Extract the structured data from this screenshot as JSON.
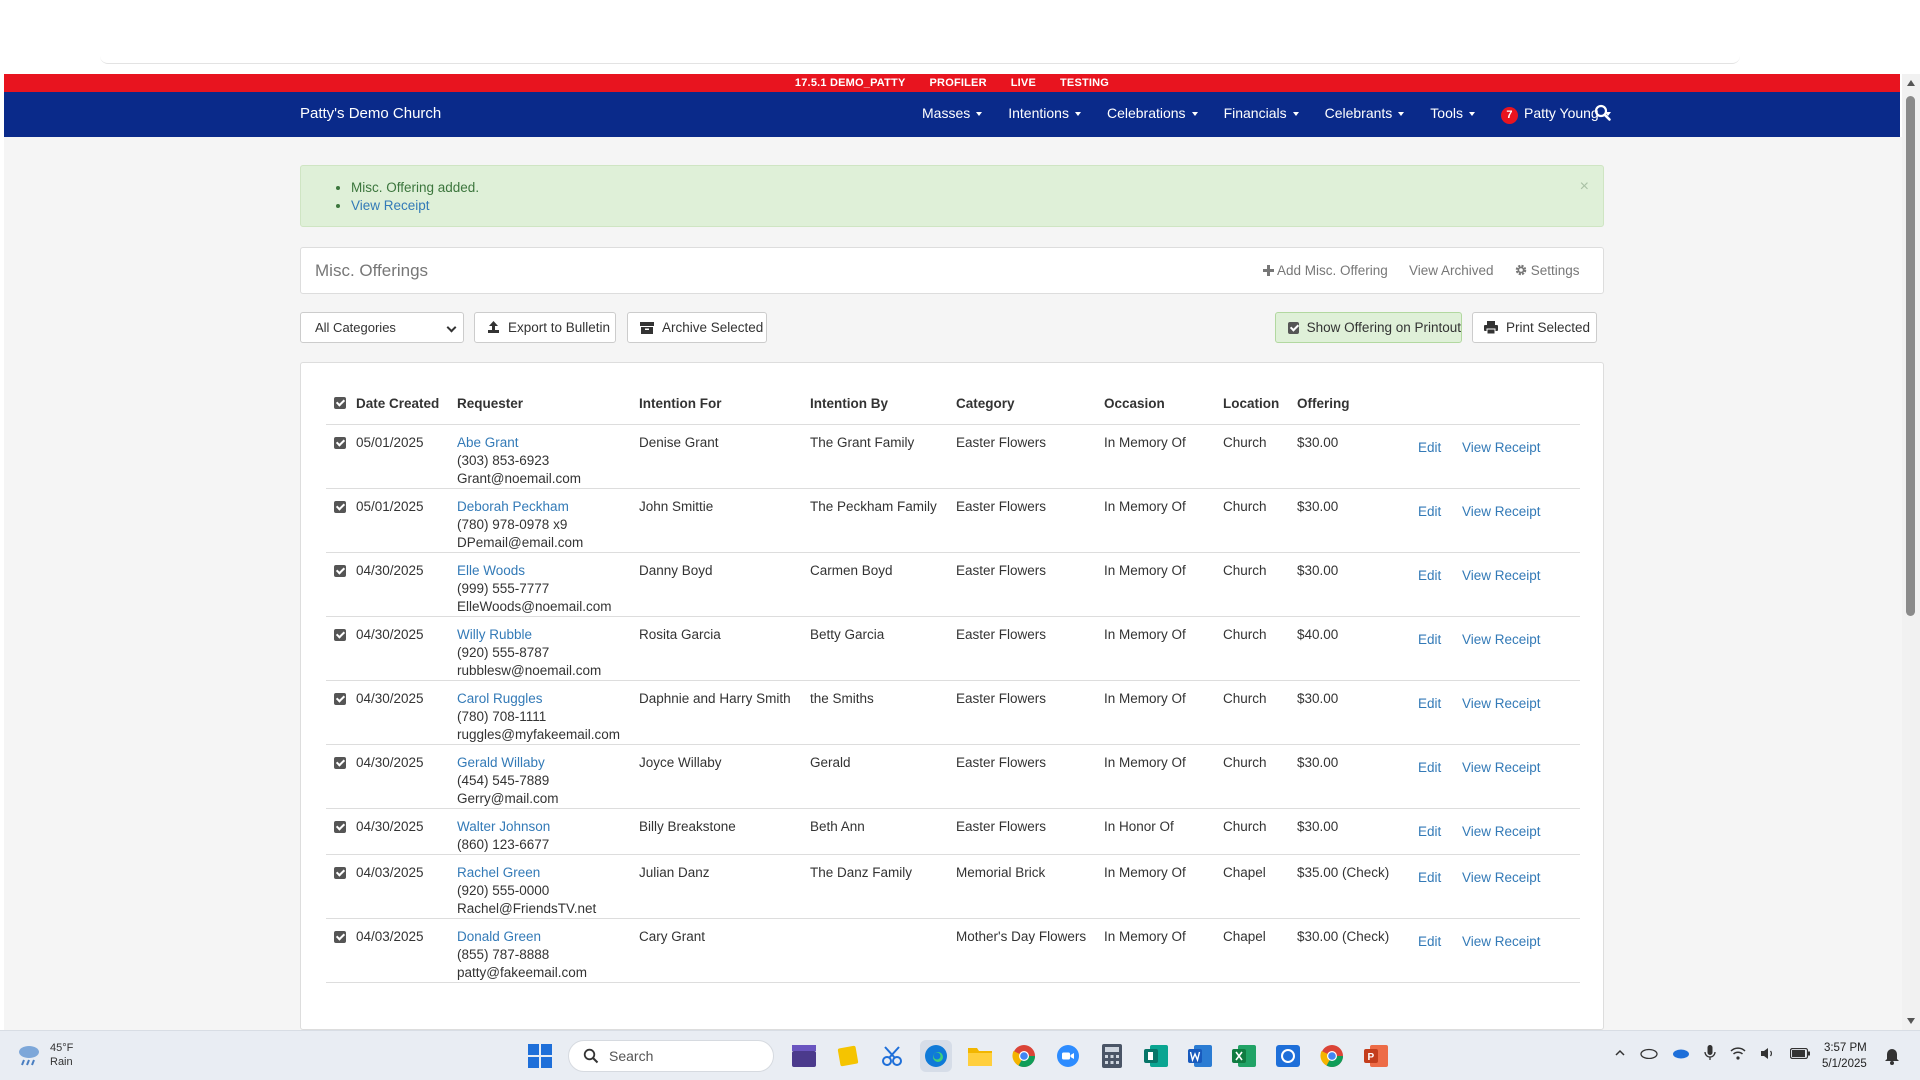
{
  "env_bar": [
    "17.5.1 DEMO_PATTY",
    "PROFILER",
    "LIVE",
    "TESTING"
  ],
  "brand": "Patty's Demo Church",
  "nav": {
    "masses": "Masses",
    "intentions": "Intentions",
    "celebrations": "Celebrations",
    "financials": "Financials",
    "celebrants": "Celebrants",
    "tools": "Tools",
    "user_badge": "7",
    "user_name": "Patty Young"
  },
  "alert": {
    "message": "Misc. Offering added.",
    "link": "View Receipt",
    "close": "×"
  },
  "panel": {
    "title": "Misc. Offerings",
    "add": "Add Misc. Offering",
    "view_archived": "View Archived",
    "settings": "Settings"
  },
  "toolbar": {
    "category_select": "All Categories",
    "export": "Export to Bulletin",
    "archive": "Archive Selected",
    "show_offering": "Show Offering on Printout",
    "print": "Print Selected"
  },
  "table": {
    "columns": [
      "Date Created",
      "Requester",
      "Intention For",
      "Intention By",
      "Category",
      "Occasion",
      "Location",
      "Offering"
    ],
    "edit_label": "Edit",
    "receipt_label": "View Receipt",
    "rows": [
      {
        "date": "05/01/2025",
        "name": "Abe Grant",
        "phone": "(303) 853-6923",
        "email": "Grant@noemail.com",
        "intention_for": "Denise Grant",
        "intention_by": "The Grant Family",
        "category": "Easter Flowers",
        "occasion": "In Memory Of",
        "location": "Church",
        "offering": "$30.00"
      },
      {
        "date": "05/01/2025",
        "name": "Deborah Peckham",
        "phone": "(780) 978-0978 x9",
        "email": "DPemail@email.com",
        "intention_for": "John Smittie",
        "intention_by": "The Peckham Family",
        "category": "Easter Flowers",
        "occasion": "In Memory Of",
        "location": "Church",
        "offering": "$30.00"
      },
      {
        "date": "04/30/2025",
        "name": "Elle Woods",
        "phone": "(999) 555-7777",
        "email": "ElleWoods@noemail.com",
        "intention_for": "Danny Boyd",
        "intention_by": "Carmen Boyd",
        "category": "Easter Flowers",
        "occasion": "In Memory Of",
        "location": "Church",
        "offering": "$30.00"
      },
      {
        "date": "04/30/2025",
        "name": "Willy Rubble",
        "phone": "(920) 555-8787",
        "email": "rubblesw@noemail.com",
        "intention_for": "Rosita Garcia",
        "intention_by": "Betty Garcia",
        "category": "Easter Flowers",
        "occasion": "In Memory Of",
        "location": "Church",
        "offering": "$40.00"
      },
      {
        "date": "04/30/2025",
        "name": "Carol Ruggles",
        "phone": "(780) 708-1111",
        "email": "ruggles@myfakeemail.com",
        "intention_for": "Daphnie and Harry Smith",
        "intention_by": "the Smiths",
        "category": "Easter Flowers",
        "occasion": "In Memory Of",
        "location": "Church",
        "offering": "$30.00"
      },
      {
        "date": "04/30/2025",
        "name": "Gerald Willaby",
        "phone": "(454) 545-7889",
        "email": "Gerry@mail.com",
        "intention_for": "Joyce Willaby",
        "intention_by": "Gerald",
        "category": "Easter Flowers",
        "occasion": "In Memory Of",
        "location": "Church",
        "offering": "$30.00"
      },
      {
        "date": "04/30/2025",
        "name": "Walter Johnson",
        "phone": "(860) 123-6677",
        "email": "",
        "intention_for": "Billy Breakstone",
        "intention_by": "Beth Ann",
        "category": "Easter Flowers",
        "occasion": "In Honor Of",
        "location": "Church",
        "offering": "$30.00"
      },
      {
        "date": "04/03/2025",
        "name": "Rachel Green",
        "phone": "(920) 555-0000",
        "email": "Rachel@FriendsTV.net",
        "intention_for": "Julian Danz",
        "intention_by": "The Danz Family",
        "category": "Memorial Brick",
        "occasion": "In Memory Of",
        "location": "Chapel",
        "offering": "$35.00 (Check)"
      },
      {
        "date": "04/03/2025",
        "name": "Donald Green",
        "phone": "(855) 787-8888",
        "email": "patty@fakeemail.com",
        "intention_for": "Cary Grant",
        "intention_by": "",
        "category": "Mother's Day Flowers",
        "occasion": "In Memory Of",
        "location": "Chapel",
        "offering": "$30.00 (Check)"
      }
    ]
  },
  "taskbar": {
    "weather_temp": "45°F",
    "weather_desc": "Rain",
    "search_label": "Search",
    "time": "3:57 PM",
    "date": "5/1/2025"
  },
  "colors": {
    "navbar": "#0a2a8a",
    "env_bar": "#e8141f",
    "alert_bg": "#dff0d8",
    "link": "#337ab7"
  }
}
